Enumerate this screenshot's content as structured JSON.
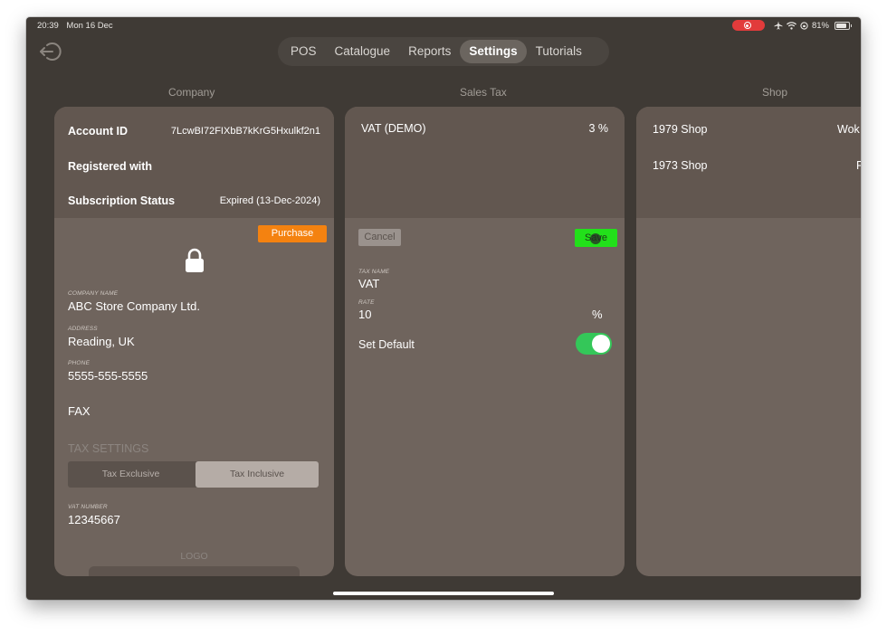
{
  "status_bar": {
    "time": "20:39",
    "date": "Mon 16 Dec",
    "battery": "81%",
    "battery_level": 0.81
  },
  "nav": {
    "tabs": [
      {
        "label": "POS"
      },
      {
        "label": "Catalogue"
      },
      {
        "label": "Reports"
      },
      {
        "label": "Settings",
        "active": true
      },
      {
        "label": "Tutorials"
      }
    ]
  },
  "columns": {
    "company": "Company",
    "sales_tax": "Sales Tax",
    "shop": "Shop"
  },
  "company": {
    "account_id_label": "Account ID",
    "account_id": "7LcwBI72FIXbB7kKrG5Hxulkf2n1",
    "registered_label": "Registered with",
    "subscription_label": "Subscription Status",
    "subscription_value": "Expired (13-Dec-2024)",
    "purchase_label": "Purchase",
    "company_name_caption": "COMPANY NAME",
    "company_name": "ABC Store Company Ltd.",
    "address_caption": "ADDRESS",
    "address": "Reading, UK",
    "phone_caption": "PHONE",
    "phone": "5555-555-5555",
    "fax_label": "FAX",
    "tax_settings_title": "TAX SETTINGS",
    "tax_exclusive": "Tax Exclusive",
    "tax_inclusive": "Tax Inclusive",
    "vat_caption": "VAT NUMBER",
    "vat_number": "12345667",
    "logo_title": "LOGO"
  },
  "sales_tax": {
    "item_name": "VAT (DEMO)",
    "item_rate": "3 %",
    "cancel_label": "Cancel",
    "save_label": "Save",
    "tax_name_caption": "TAX NAME",
    "tax_name": "VAT",
    "rate_caption": "RATE",
    "rate": "10",
    "rate_unit": "%",
    "set_default_label": "Set Default",
    "set_default": true
  },
  "shop": {
    "items": [
      {
        "name": "1979 Shop",
        "extra": "Wok"
      },
      {
        "name": "1973 Shop",
        "extra": "F"
      }
    ]
  },
  "colors": {
    "purchase": "#f48210",
    "save": "#22e01a",
    "toggle_on": "#34c759",
    "recording": "#e23b3b"
  }
}
